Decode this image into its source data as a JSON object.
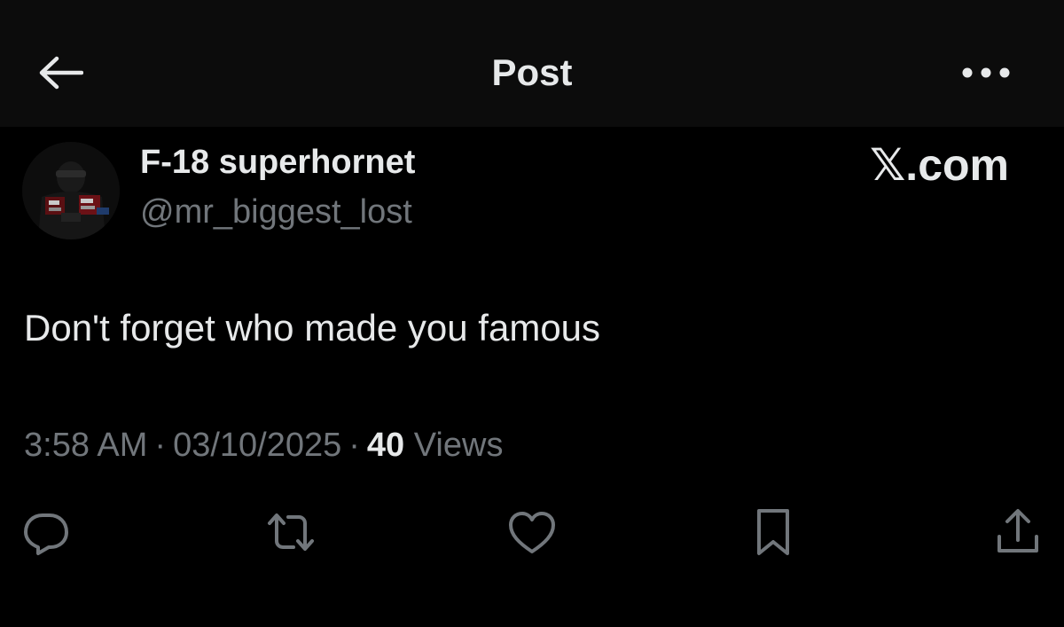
{
  "header": {
    "title": "Post",
    "back_icon": "arrow-left-icon",
    "more_icon": "more-horizontal-icon"
  },
  "author": {
    "name": "F-18 superhornet",
    "handle": "@mr_biggest_lost",
    "avatar_icon": "avatar-image"
  },
  "watermark": "𝕏.com",
  "post": {
    "text": "Don't forget who made you famous"
  },
  "meta": {
    "time": "3:58 AM",
    "separator": "·",
    "date": "03/10/2025",
    "views_count": "40",
    "views_label": "Views"
  },
  "actions": {
    "reply_icon": "reply-icon",
    "repost_icon": "repost-icon",
    "like_icon": "heart-icon",
    "bookmark_icon": "bookmark-icon",
    "share_icon": "share-icon"
  },
  "colors": {
    "background": "#000000",
    "header_background": "#0c0c0c",
    "primary_text": "#e7e9ea",
    "secondary_text": "#71767b"
  }
}
